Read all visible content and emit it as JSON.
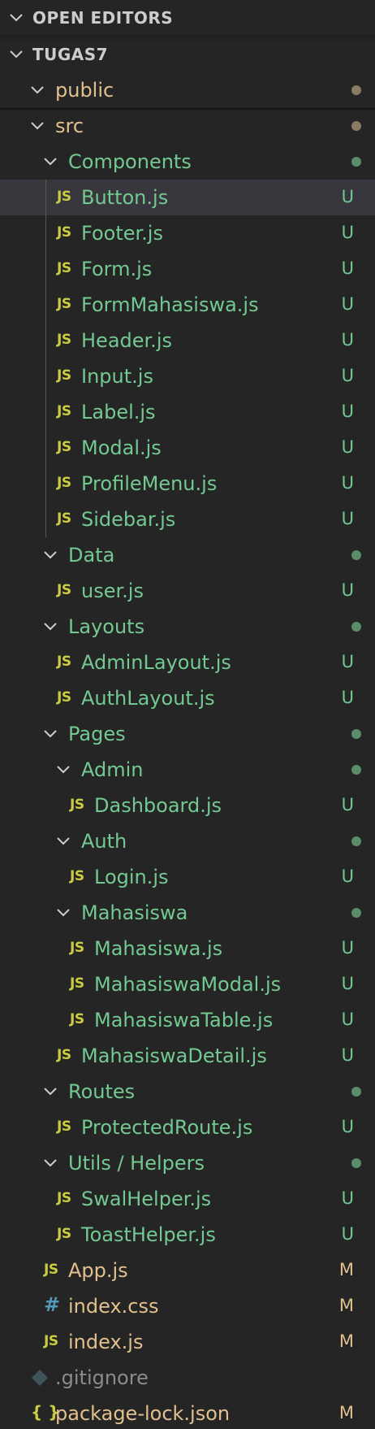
{
  "colors": {
    "background": "#252526",
    "selected_row": "#37373d",
    "untracked": "#73c991",
    "modified": "#e2c08d",
    "ignored": "#8c8c8c",
    "dot_untracked": "#5a8d6a",
    "dot_modified": "#8a7c63",
    "js_icon": "#cbcb41",
    "css_icon": "#519aba"
  },
  "sections": {
    "open_editors": "OPEN EDITORS",
    "project": "TUGAS7"
  },
  "tree": [
    {
      "name": "public",
      "type": "folder",
      "depth": 0,
      "status": "modified-dot"
    },
    {
      "name": "src",
      "type": "folder",
      "depth": 0,
      "status": "modified-dot"
    },
    {
      "name": "Components",
      "type": "folder",
      "depth": 1,
      "status": "untracked-dot"
    },
    {
      "name": "Button.js",
      "type": "js",
      "depth": 2,
      "status": "U",
      "selected": true
    },
    {
      "name": "Footer.js",
      "type": "js",
      "depth": 2,
      "status": "U"
    },
    {
      "name": "Form.js",
      "type": "js",
      "depth": 2,
      "status": "U"
    },
    {
      "name": "FormMahasiswa.js",
      "type": "js",
      "depth": 2,
      "status": "U"
    },
    {
      "name": "Header.js",
      "type": "js",
      "depth": 2,
      "status": "U"
    },
    {
      "name": "Input.js",
      "type": "js",
      "depth": 2,
      "status": "U"
    },
    {
      "name": "Label.js",
      "type": "js",
      "depth": 2,
      "status": "U"
    },
    {
      "name": "Modal.js",
      "type": "js",
      "depth": 2,
      "status": "U"
    },
    {
      "name": "ProfileMenu.js",
      "type": "js",
      "depth": 2,
      "status": "U"
    },
    {
      "name": "Sidebar.js",
      "type": "js",
      "depth": 2,
      "status": "U"
    },
    {
      "name": "Data",
      "type": "folder",
      "depth": 1,
      "status": "untracked-dot"
    },
    {
      "name": "user.js",
      "type": "js",
      "depth": 2,
      "status": "U"
    },
    {
      "name": "Layouts",
      "type": "folder",
      "depth": 1,
      "status": "untracked-dot"
    },
    {
      "name": "AdminLayout.js",
      "type": "js",
      "depth": 2,
      "status": "U"
    },
    {
      "name": "AuthLayout.js",
      "type": "js",
      "depth": 2,
      "status": "U"
    },
    {
      "name": "Pages",
      "type": "folder",
      "depth": 1,
      "status": "untracked-dot"
    },
    {
      "name": "Admin",
      "type": "folder",
      "depth": 2,
      "status": "untracked-dot"
    },
    {
      "name": "Dashboard.js",
      "type": "js",
      "depth": 3,
      "status": "U"
    },
    {
      "name": "Auth",
      "type": "folder",
      "depth": 2,
      "status": "untracked-dot"
    },
    {
      "name": "Login.js",
      "type": "js",
      "depth": 3,
      "status": "U"
    },
    {
      "name": "Mahasiswa",
      "type": "folder",
      "depth": 2,
      "status": "untracked-dot"
    },
    {
      "name": "Mahasiswa.js",
      "type": "js",
      "depth": 3,
      "status": "U"
    },
    {
      "name": "MahasiswaModal.js",
      "type": "js",
      "depth": 3,
      "status": "U"
    },
    {
      "name": "MahasiswaTable.js",
      "type": "js",
      "depth": 3,
      "status": "U"
    },
    {
      "name": "MahasiswaDetail.js",
      "type": "js",
      "depth": 2,
      "status": "U"
    },
    {
      "name": "Routes",
      "type": "folder",
      "depth": 1,
      "status": "untracked-dot"
    },
    {
      "name": "ProtectedRoute.js",
      "type": "js",
      "depth": 2,
      "status": "U"
    },
    {
      "name": "Utils / Helpers",
      "type": "folder",
      "depth": 1,
      "status": "untracked-dot"
    },
    {
      "name": "SwalHelper.js",
      "type": "js",
      "depth": 2,
      "status": "U"
    },
    {
      "name": "ToastHelper.js",
      "type": "js",
      "depth": 2,
      "status": "U"
    },
    {
      "name": "App.js",
      "type": "js",
      "depth": 1,
      "status": "M"
    },
    {
      "name": "index.css",
      "type": "css",
      "depth": 1,
      "status": "M"
    },
    {
      "name": "index.js",
      "type": "js",
      "depth": 1,
      "status": "M"
    },
    {
      "name": ".gitignore",
      "type": "git",
      "depth": 0,
      "status": ""
    },
    {
      "name": "package-lock.json",
      "type": "json",
      "depth": 0,
      "status": "M"
    }
  ]
}
